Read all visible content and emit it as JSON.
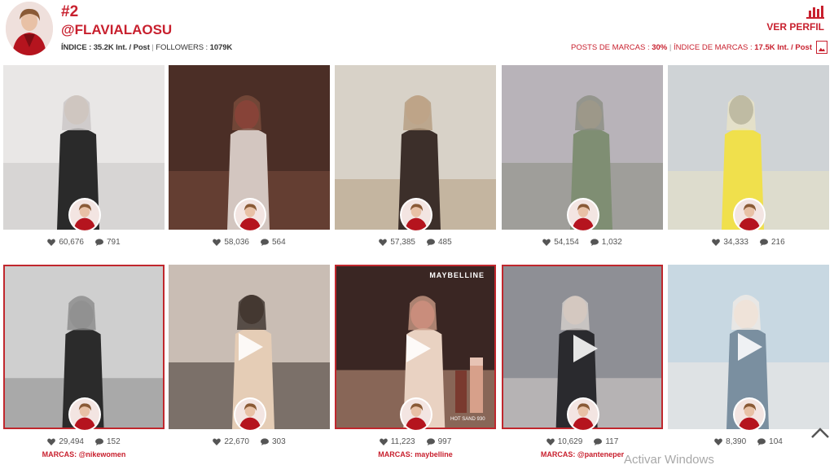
{
  "profile": {
    "rank": "#2",
    "handle": "@FLAVIALAOSU",
    "indice_label": "ÍNDICE :",
    "indice_value": "35.2K Int. / Post",
    "followers_label": "FOLLOWERS :",
    "followers_value": "1079K"
  },
  "header_right": {
    "ver_perfil": "VER PERFIL",
    "posts_label": "POSTS DE MARCAS :",
    "posts_value": "30%",
    "indice_label": "ÍNDICE DE MARCAS :",
    "indice_value": "17.5K Int. / Post"
  },
  "colors": {
    "accent": "#c8202e",
    "brand_border": "#c0272d"
  },
  "posts": [
    {
      "likes": "60,676",
      "comments": "791",
      "video": false,
      "brand": ""
    },
    {
      "likes": "58,036",
      "comments": "564",
      "video": false,
      "brand": ""
    },
    {
      "likes": "57,385",
      "comments": "485",
      "video": false,
      "brand": ""
    },
    {
      "likes": "54,154",
      "comments": "1,032",
      "video": false,
      "brand": ""
    },
    {
      "likes": "34,333",
      "comments": "216",
      "video": false,
      "brand": ""
    },
    {
      "likes": "29,494",
      "comments": "152",
      "video": false,
      "brand": "@nikewomen",
      "marcas_label": "MARCAS:"
    },
    {
      "likes": "22,670",
      "comments": "303",
      "video": true,
      "brand": ""
    },
    {
      "likes": "11,223",
      "comments": "997",
      "video": true,
      "brand": "maybelline",
      "marcas_label": "MARCAS:",
      "overlay_text": "MAYBELLINE",
      "overlay_sub": "HOT SAND 930"
    },
    {
      "likes": "10,629",
      "comments": "117",
      "video": true,
      "brand": "@panteneper",
      "marcas_label": "MARCAS:"
    },
    {
      "likes": "8,390",
      "comments": "104",
      "video": true,
      "brand": ""
    }
  ],
  "watermark": "Activar Windows",
  "icons": [
    "bar-chart-icon",
    "pdf-icon",
    "heart-icon",
    "comment-icon",
    "play-icon",
    "chevron-up-icon"
  ]
}
